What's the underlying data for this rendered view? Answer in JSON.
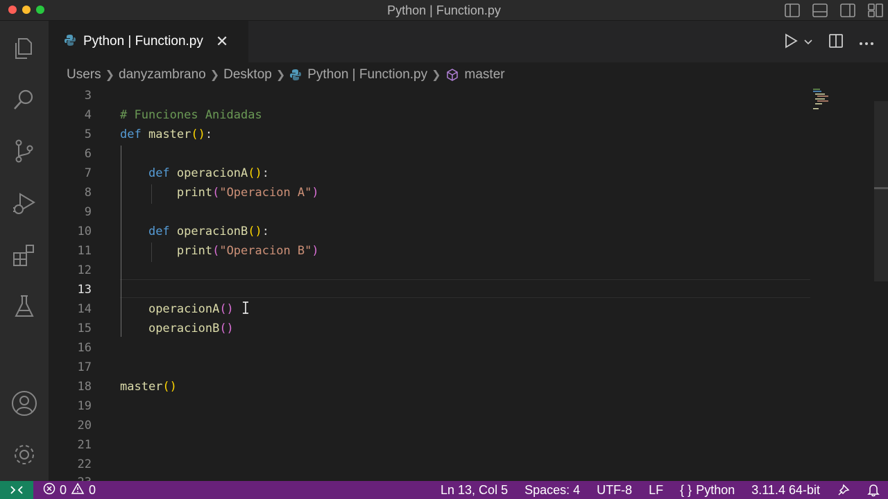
{
  "window": {
    "title": "Python | Function.py"
  },
  "tab": {
    "label": "Python | Function.py",
    "close": "✕"
  },
  "breadcrumb": {
    "items": [
      "Users",
      "danyzambrano",
      "Desktop",
      "Python | Function.py",
      "master"
    ]
  },
  "editor": {
    "active_line": 13,
    "lines": [
      {
        "n": "3"
      },
      {
        "n": "4"
      },
      {
        "n": "5"
      },
      {
        "n": "6"
      },
      {
        "n": "7"
      },
      {
        "n": "8"
      },
      {
        "n": "9"
      },
      {
        "n": "10"
      },
      {
        "n": "11"
      },
      {
        "n": "12"
      },
      {
        "n": "13"
      },
      {
        "n": "14"
      },
      {
        "n": "15"
      },
      {
        "n": "16"
      },
      {
        "n": "17"
      },
      {
        "n": "18"
      },
      {
        "n": "19"
      },
      {
        "n": "20"
      },
      {
        "n": "21"
      },
      {
        "n": "22"
      },
      {
        "n": "23"
      }
    ],
    "code": {
      "comment": "# Funciones Anidadas",
      "kw_def": "def",
      "master_name": "master",
      "opA_name": "operacionA",
      "opB_name": "operacionB",
      "print": "print",
      "strA": "\"Operacion A\"",
      "strB": "\"Operacion B\"",
      "parens": "()",
      "colon": ":",
      "open": "(",
      "close": ")"
    }
  },
  "statusbar": {
    "errors": "0",
    "warnings": "0",
    "position": "Ln 13, Col 5",
    "spaces": "Spaces: 4",
    "encoding": "UTF-8",
    "eol": "LF",
    "brackets": "{ }",
    "language": "Python",
    "interpreter": "3.11.4 64-bit"
  },
  "colors": {
    "statusbar": "#68217a",
    "remote": "#16825d",
    "editor_bg": "#1e1e1e"
  },
  "icons": {
    "activity": [
      "explorer-icon",
      "search-icon",
      "source-control-icon",
      "run-debug-icon",
      "extensions-icon",
      "testing-icon",
      "account-icon",
      "settings-gear-icon"
    ]
  }
}
